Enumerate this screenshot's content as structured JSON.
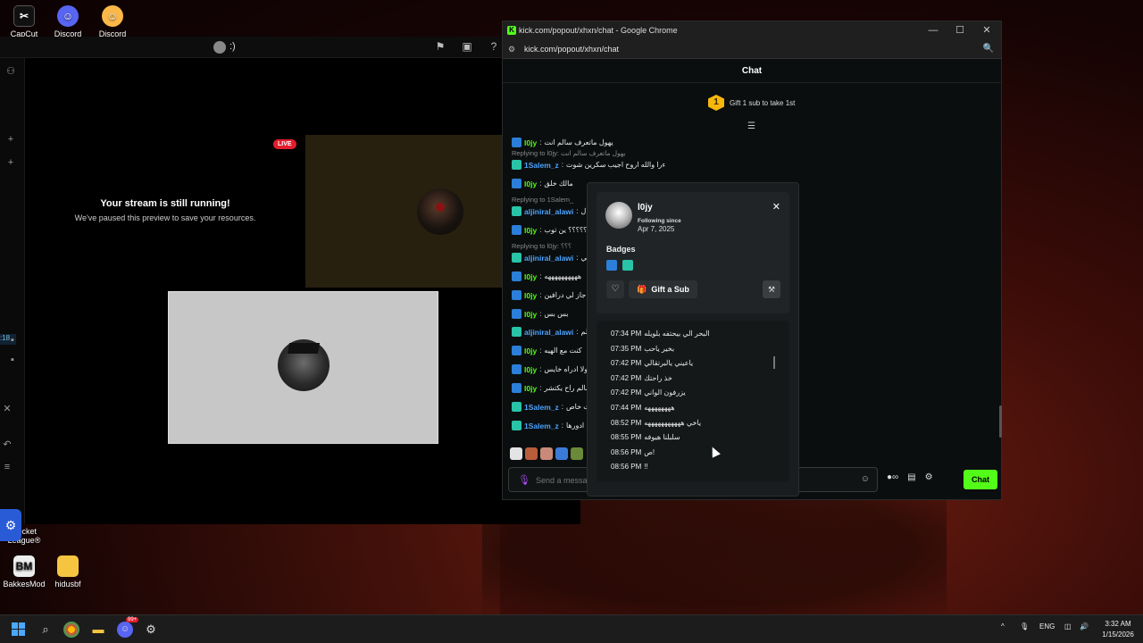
{
  "desktop": {
    "icons": [
      {
        "label": "CapCut"
      },
      {
        "label": "Discord"
      },
      {
        "label": "Discord Canary"
      },
      {
        "label": "Rocket League®"
      },
      {
        "label": "BakkesMod"
      },
      {
        "label": "hidusbf"
      }
    ]
  },
  "app": {
    "stream_user_suffix": ":)",
    "paused_title": "Your stream is still running!",
    "paused_subtitle": "We've paused this preview to save your resources.",
    "live_badge": "LIVE",
    "rail_time": ":18"
  },
  "browser": {
    "title": "kick.com/popout/xhxn/chat - Google Chrome",
    "url": "kick.com/popout/xhxn/chat"
  },
  "chat": {
    "header": "Chat",
    "gift_rank": "1",
    "gift_text": "Gift 1 sub to take 1st",
    "messages": [
      {
        "user": "l0jy",
        "text": "يهول ماتعرف سالم انت",
        "badge": "b1",
        "color": "#53fc18"
      },
      {
        "reply": "Replying to l0jy: يهول ماتعرف سالم انت"
      },
      {
        "user": "1Salem_z",
        "text": "ءرا والله اروح اجيب سكرين شوت",
        "badge": "b2",
        "color": "#4aa3ff"
      },
      {
        "user": "l0jy",
        "text": "مالك خلق",
        "badge": "b1",
        "color": "#53fc18"
      },
      {
        "reply": "Replying to 1Salem_"
      },
      {
        "user": "aljiniral_alawi",
        "text": "ل",
        "badge": "b2",
        "color": "#4aa3ff"
      },
      {
        "user": "l0jy",
        "text": "؟؟؟؟؟؟ ين توب",
        "badge": "b1",
        "color": "#53fc18"
      },
      {
        "reply": "Replying to l0jy: ؟؟؟"
      },
      {
        "user": "aljiniral_alawi",
        "text": "لي",
        "badge": "b2",
        "color": "#4aa3ff"
      },
      {
        "user": "l0jy",
        "text": "ههههههههههه",
        "badge": "b1",
        "color": "#53fc18"
      },
      {
        "user": "l0jy",
        "text": "جاز لي درافين",
        "badge": "b1",
        "color": "#53fc18"
      },
      {
        "user": "l0jy",
        "text": "بس بس",
        "badge": "b1",
        "color": "#53fc18"
      },
      {
        "user": "aljiniral_alawi",
        "text": "لم",
        "badge": "b2",
        "color": "#4aa3ff"
      },
      {
        "user": "l0jy",
        "text": "كنت مع الهيه",
        "badge": "b1",
        "color": "#53fc18"
      },
      {
        "user": "l0jy",
        "text": "ولا ادراه خايس",
        "badge": "b1",
        "color": "#53fc18"
      },
      {
        "user": "l0jy",
        "text": "سالم راح يكتشر",
        "badge": "b1",
        "color": "#53fc18"
      },
      {
        "user": "1Salem_z",
        "text": "ت خاص",
        "badge": "b2",
        "color": "#4aa3ff"
      },
      {
        "user": "1Salem_z",
        "text": "ادورها",
        "badge": "b2",
        "color": "#4aa3ff"
      }
    ],
    "input_placeholder": "Send a message",
    "send_label": "Chat"
  },
  "user_card": {
    "username": "l0jy",
    "following_label": "Following since",
    "following_date": "Apr 7, 2025",
    "badges_title": "Badges",
    "gift_label": "Gift a Sub",
    "history": [
      {
        "time": "07:34 PM",
        "text": "البحر الي بيحتفه بلويله"
      },
      {
        "time": "07:35 PM",
        "text": "بخير ياحب"
      },
      {
        "time": "07:42 PM",
        "text": "ياعيني يالبرتقالي"
      },
      {
        "time": "07:42 PM",
        "text": "خذ راحتك"
      },
      {
        "time": "07:42 PM",
        "text": "يزرفون الواني"
      },
      {
        "time": "07:44 PM",
        "text": "ههههههههه"
      },
      {
        "time": "08:52 PM",
        "text": "ياخي هههههههههههه"
      },
      {
        "time": "08:55 PM",
        "text": "سلبلنا هيوفه"
      },
      {
        "time": "08:56 PM",
        "text": "ص!"
      },
      {
        "time": "08:56 PM",
        "text": "!!"
      }
    ]
  },
  "taskbar": {
    "lang": "ENG",
    "time": "3:32 AM",
    "date": "1/15/2026",
    "discord_badge": "99+"
  },
  "colors": {
    "kick_green": "#53fc18",
    "live_red": "#e21e2e",
    "gift_gold": "#f5b70c"
  }
}
